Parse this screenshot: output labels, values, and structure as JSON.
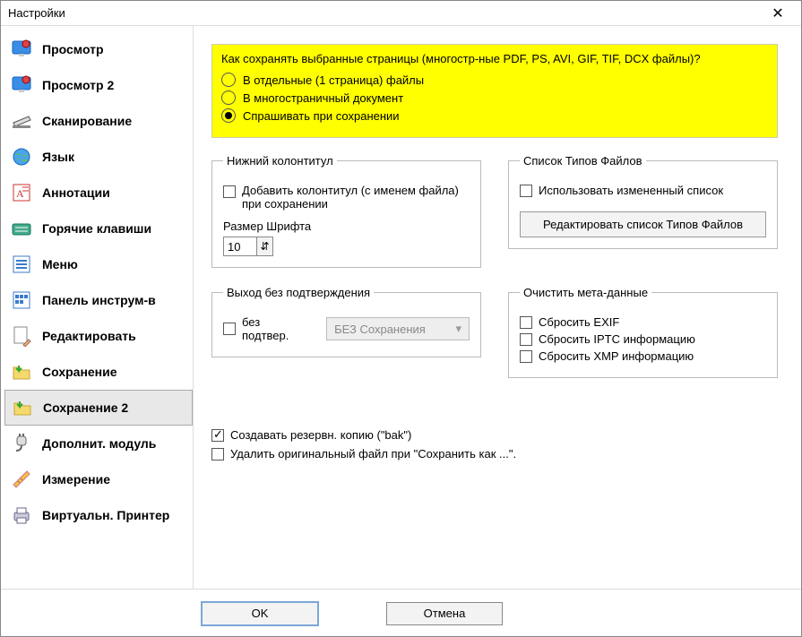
{
  "window": {
    "title": "Настройки",
    "close": "✕"
  },
  "sidebar": [
    {
      "key": "view",
      "label": "Просмотр"
    },
    {
      "key": "view2",
      "label": "Просмотр 2"
    },
    {
      "key": "scan",
      "label": "Сканирование"
    },
    {
      "key": "lang",
      "label": "Язык"
    },
    {
      "key": "annot",
      "label": "Аннотации"
    },
    {
      "key": "hotkeys",
      "label": "Горячие клавиши"
    },
    {
      "key": "menu",
      "label": "Меню"
    },
    {
      "key": "toolbar",
      "label": "Панель инструм-в"
    },
    {
      "key": "edit",
      "label": "Редактировать"
    },
    {
      "key": "save",
      "label": "Сохранение"
    },
    {
      "key": "save2",
      "label": "Сохранение 2"
    },
    {
      "key": "plugin",
      "label": "Дополнит. модуль"
    },
    {
      "key": "measure",
      "label": "Измерение"
    },
    {
      "key": "vprint",
      "label": "Виртуальн. Принтер"
    }
  ],
  "highlight": {
    "question": "Как сохранять выбранные страницы (многостр-ные PDF, PS, AVI, GIF, TIF, DCX файлы)?",
    "opt1": "В отдельные (1 страница) файлы",
    "opt2": "В многостраничный документ",
    "opt3": "Спрашивать при сохранении"
  },
  "footer_group": {
    "legend": "Нижний колонтитул",
    "add_label_a": "Добавить колонтитул (с именем файла)",
    "add_label_b": "при сохранении",
    "font_label": "Размер Шрифта",
    "font_value": "10"
  },
  "filetypes_group": {
    "legend": "Список Типов Файлов",
    "use_modified": "Использовать измененный список",
    "edit_btn": "Редактировать список Типов Файлов"
  },
  "exit_group": {
    "legend": "Выход без подтверждения",
    "no_confirm": "без подтвер.",
    "select_value": "БЕЗ Сохранения"
  },
  "meta_group": {
    "legend": "Очистить мета-данные",
    "reset_exif": "Сбросить EXIF",
    "reset_iptc": "Сбросить IPTC информацию",
    "reset_xmp": "Сбросить XMP информацию"
  },
  "extra": {
    "make_backup": "Создавать резервн. копию (\"bak\")",
    "delete_original": "Удалить оригинальный файл при \"Сохранить как ...\"."
  },
  "buttons": {
    "ok": "OK",
    "cancel": "Отмена"
  }
}
